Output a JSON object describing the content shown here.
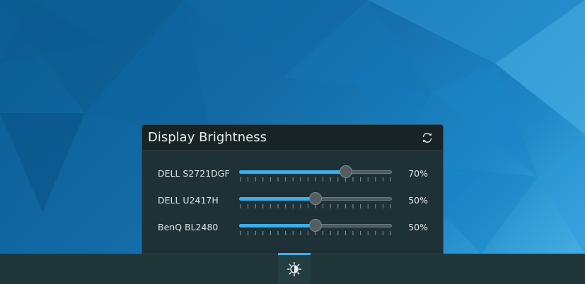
{
  "popup": {
    "title": "Display Brightness",
    "refresh_icon": "refresh-icon"
  },
  "monitors": [
    {
      "name": "DELL S2721DGF",
      "value": "70%",
      "level": 0.7
    },
    {
      "name": "DELL U2417H",
      "value": "50%",
      "level": 0.5
    },
    {
      "name": "BenQ BL2480",
      "value": "50%",
      "level": 0.5
    }
  ],
  "taskbar": {
    "tray_icon": "brightness-icon"
  },
  "colors": {
    "accent": "#3daee9",
    "popup_bg": "#1d3136",
    "taskbar_bg": "#1f3538"
  }
}
